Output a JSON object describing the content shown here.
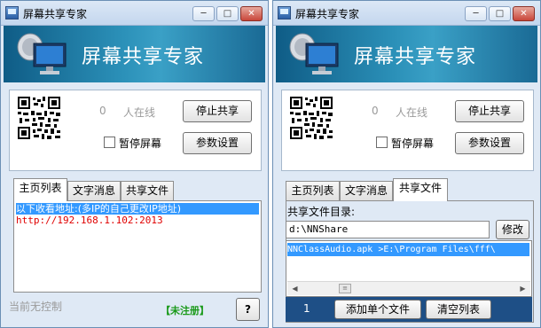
{
  "left_window": {
    "title": "屏幕共享专家",
    "banner_title": "屏幕共享专家",
    "online_count": "0",
    "online_label": "人在线",
    "stop_share_label": "停止共享",
    "pause_label": "暂停屏幕",
    "settings_label": "参数设置",
    "tabs": [
      "主页列表",
      "文字消息",
      "共享文件"
    ],
    "active_tab": "主页列表",
    "list_items": [
      "以下收看地址:(多IP的自己更改IP地址)",
      "http://192.168.1.102:2013"
    ],
    "status_text": "当前无控制",
    "unregistered_label": "【未注册】",
    "help_label": "?"
  },
  "right_window": {
    "title": "屏幕共享专家",
    "banner_title": "屏幕共享专家",
    "online_count": "0",
    "online_label": "人在线",
    "stop_share_label": "停止共享",
    "pause_label": "暂停屏幕",
    "settings_label": "参数设置",
    "tabs": [
      "主页列表",
      "文字消息",
      "共享文件"
    ],
    "active_tab": "共享文件",
    "dir_label": "共享文件目录:",
    "dir_value": "d:\\NNShare",
    "modify_label": "修改",
    "file_items": [
      "NNClassAudio.apk >E:\\Program Files\\fff\\"
    ],
    "file_count": "1",
    "add_file_label": "添加单个文件",
    "clear_list_label": "清空列表"
  },
  "icons": [
    "app-icon",
    "minimize-icon",
    "maximize-icon",
    "close-icon",
    "monitor-icon",
    "qr-code-icon",
    "help-icon"
  ],
  "colors": {
    "selection": "#3399ff",
    "url_text": "#e00000",
    "unregistered": "#1a9a1a",
    "banner": "#2b90b8",
    "bottombar": "#1e4f86"
  }
}
